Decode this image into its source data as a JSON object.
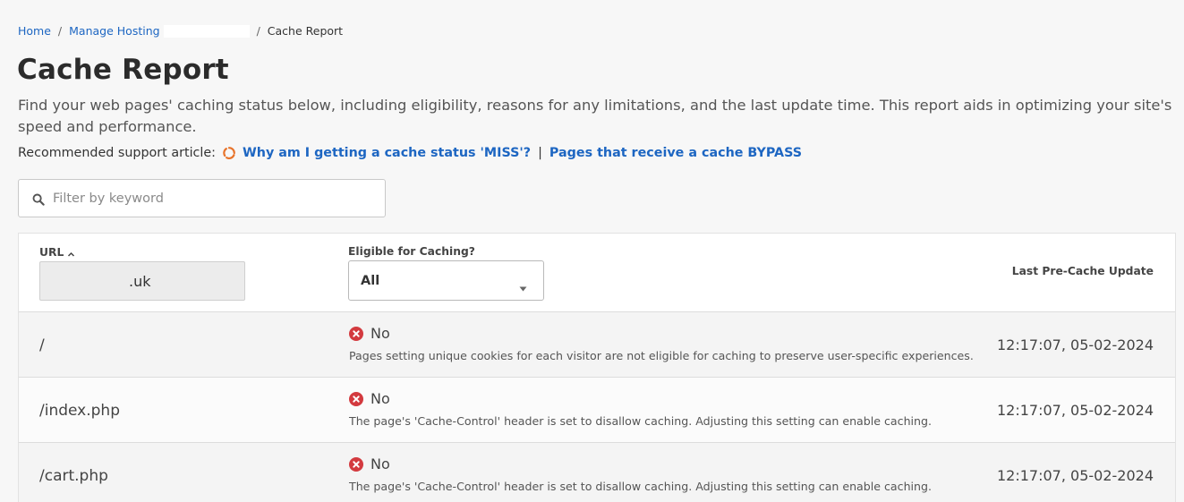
{
  "breadcrumb": {
    "home": "Home",
    "manage_hosting": "Manage Hosting",
    "current": "Cache Report"
  },
  "page": {
    "title": "Cache Report",
    "description": "Find your web pages' caching status below, including eligibility, reasons for any limitations, and the last update time. This report aids in optimizing your site's speed and performance."
  },
  "support": {
    "label": "Recommended support article:",
    "link1": "Why am I getting a cache status 'MISS'?",
    "separator": "|",
    "link2": "Pages that receive a cache BYPASS"
  },
  "filter": {
    "placeholder": "Filter by keyword"
  },
  "table": {
    "col_url": "URL",
    "url_filter_value": ".uk",
    "col_eligible": "Eligible for Caching?",
    "eligible_select": "All",
    "col_last_update": "Last Pre-Cache Update",
    "rows": [
      {
        "path": "/",
        "status": "No",
        "reason": "Pages setting unique cookies for each visitor are not eligible for caching to preserve user-specific experiences.",
        "time": "12:17:07, 05-02-2024"
      },
      {
        "path": "/index.php",
        "status": "No",
        "reason": "The page's 'Cache-Control' header is set to disallow caching. Adjusting this setting can enable caching.",
        "time": "12:17:07, 05-02-2024"
      },
      {
        "path": "/cart.php",
        "status": "No",
        "reason": "The page's 'Cache-Control' header is set to disallow caching. Adjusting this setting can enable caching.",
        "time": "12:17:07, 05-02-2024"
      }
    ]
  },
  "colors": {
    "link": "#1d66c2",
    "error": "#d33a3f",
    "spinner": "#e8742b"
  }
}
